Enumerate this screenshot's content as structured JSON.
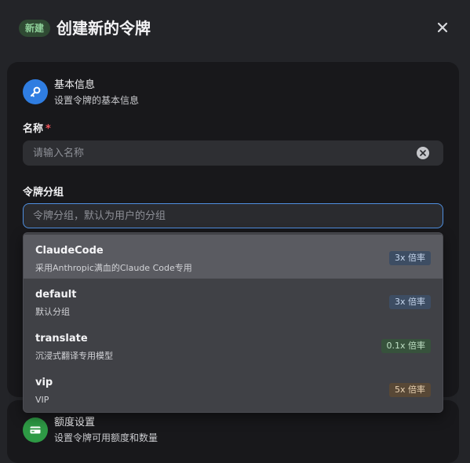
{
  "header": {
    "badge": "新建",
    "title": "创建新的令牌"
  },
  "basic": {
    "title": "基本信息",
    "subtitle": "设置令牌的基本信息",
    "icon": "key-icon",
    "icon_color": "#2f7de1"
  },
  "name_field": {
    "label": "名称",
    "required_mark": "*",
    "placeholder": "请输入名称",
    "value": ""
  },
  "group_field": {
    "label": "令牌分组",
    "placeholder": "令牌分组，默认为用户的分组",
    "value": ""
  },
  "group_options": [
    {
      "name": "ClaudeCode",
      "desc": "采用Anthropic满血的Claude Code专用",
      "rate": "3x 倍率",
      "tag_bg": "#3d4d63",
      "tag_fg": "#c8d8ef",
      "active": true
    },
    {
      "name": "default",
      "desc": "默认分组",
      "rate": "3x 倍率",
      "tag_bg": "#3d4d63",
      "tag_fg": "#c8d8ef",
      "active": false
    },
    {
      "name": "translate",
      "desc": "沉浸式翻译专用模型",
      "rate": "0.1x 倍率",
      "tag_bg": "#37523c",
      "tag_fg": "#bfe0c4",
      "active": false
    },
    {
      "name": "vip",
      "desc": "VIP",
      "rate": "5x 倍率",
      "tag_bg": "#584836",
      "tag_fg": "#ead3b4",
      "active": false
    }
  ],
  "quota": {
    "title": "额度设置",
    "subtitle": "设置令牌可用额度和数量",
    "icon": "card-icon",
    "icon_color": "#2e9a45"
  }
}
